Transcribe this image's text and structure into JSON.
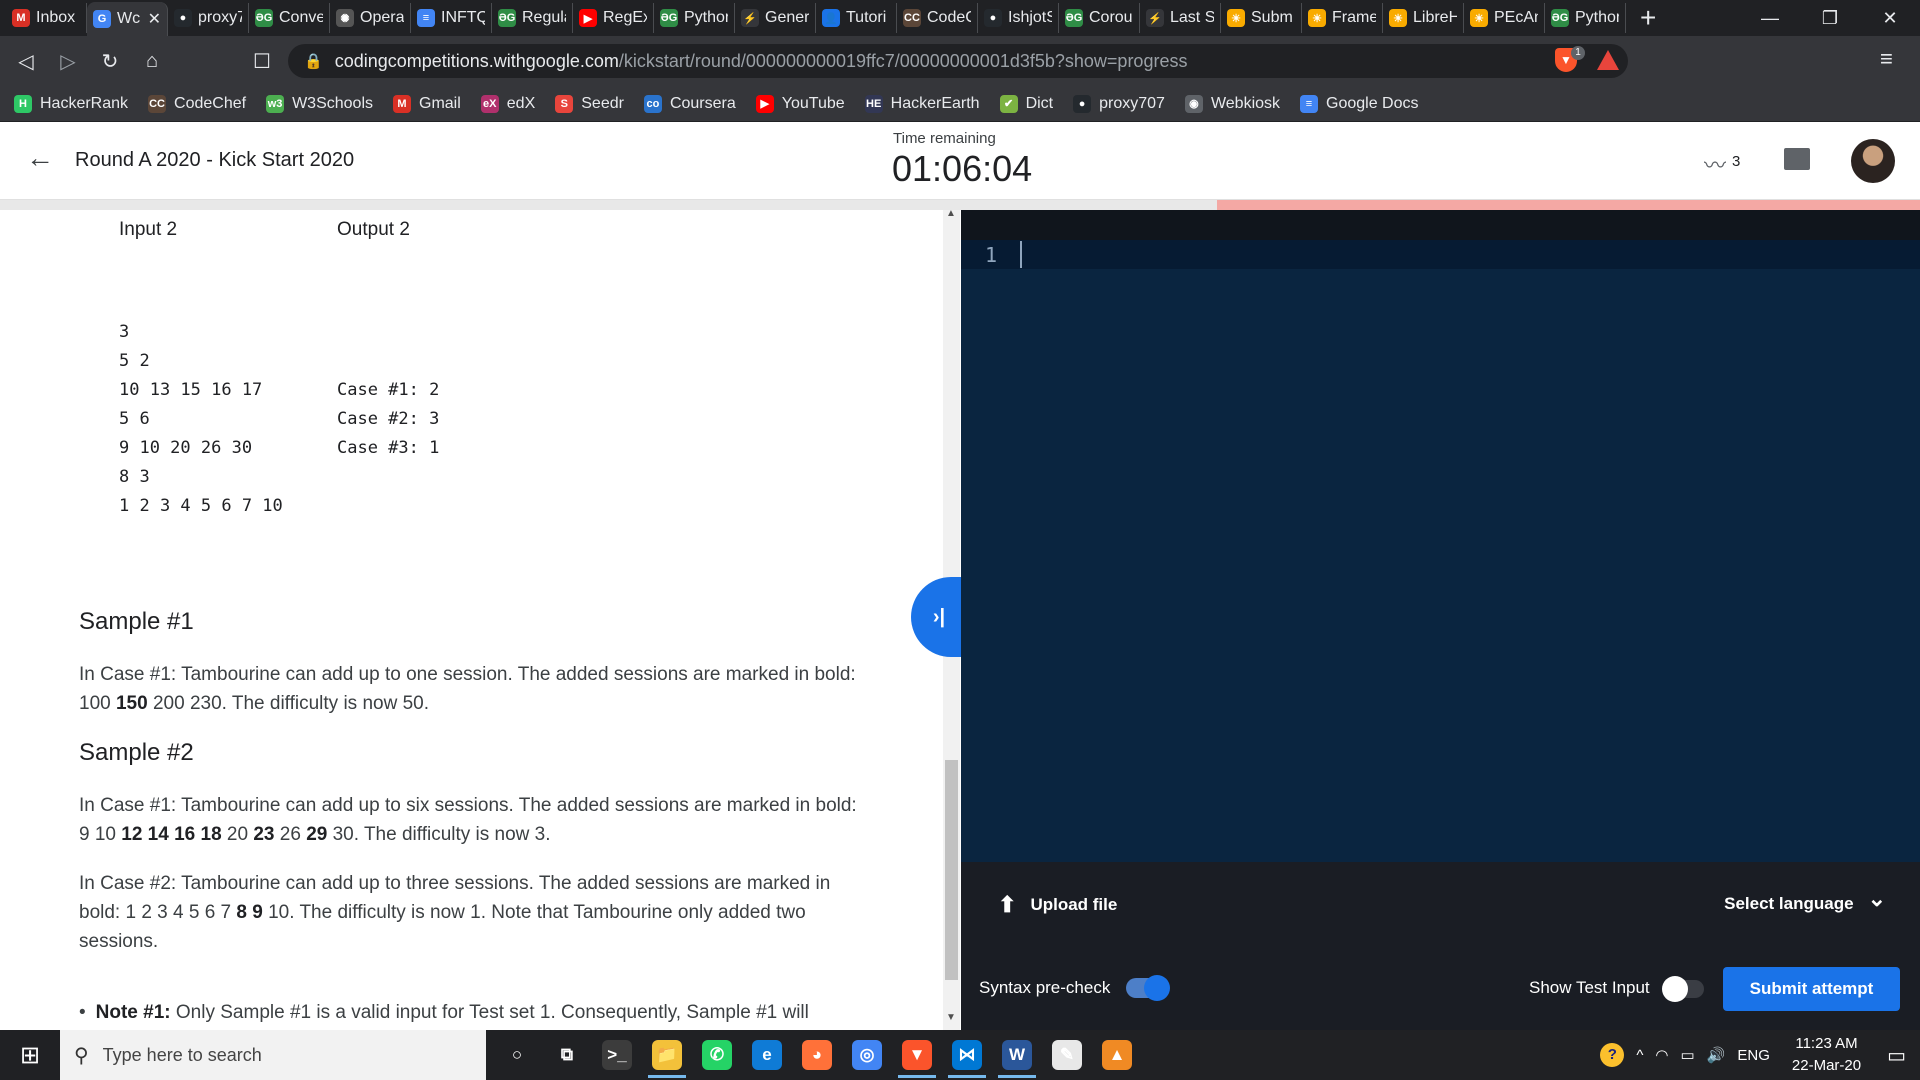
{
  "browser": {
    "tabs": [
      {
        "label": "Inbox",
        "icon": "gmail-icon",
        "color": "#d93025",
        "glyph": "M"
      },
      {
        "label": "Wc",
        "icon": "google-icon",
        "color": "#4285f4",
        "glyph": "G",
        "active": true,
        "close": "✕"
      },
      {
        "label": "proxy7",
        "icon": "github-icon",
        "color": "#24292e",
        "glyph": "●"
      },
      {
        "label": "Conve",
        "icon": "geeksforgeeks-icon",
        "color": "#2f8d46",
        "glyph": "ƏG"
      },
      {
        "label": "Opera",
        "icon": "openai-icon",
        "color": "#555555",
        "glyph": "✺"
      },
      {
        "label": "INFTQ",
        "icon": "docs-icon",
        "color": "#4285f4",
        "glyph": "≡"
      },
      {
        "label": "Regula",
        "icon": "geeksforgeeks-icon",
        "color": "#2f8d46",
        "glyph": "ƏG"
      },
      {
        "label": "RegEx",
        "icon": "youtube-icon",
        "color": "#ff0000",
        "glyph": "▶"
      },
      {
        "label": "Pythor",
        "icon": "geeksforgeeks-icon",
        "color": "#2f8d46",
        "glyph": "ƏG"
      },
      {
        "label": "Gener",
        "icon": "hackerrank-icon",
        "color": "#35363a",
        "glyph": "⚡"
      },
      {
        "label": "Tutori",
        "icon": "user-icon",
        "color": "#1a73e8",
        "glyph": "👤"
      },
      {
        "label": "CodeC",
        "icon": "codechef-icon",
        "color": "#5b4638",
        "glyph": "CC"
      },
      {
        "label": "IshjotS",
        "icon": "github-icon",
        "color": "#24292e",
        "glyph": "●"
      },
      {
        "label": "Corou",
        "icon": "geeksforgeeks-icon",
        "color": "#2f8d46",
        "glyph": "ƏG"
      },
      {
        "label": "Last St",
        "icon": "hackerrank-icon",
        "color": "#35363a",
        "glyph": "⚡"
      },
      {
        "label": "Subm",
        "icon": "sun-icon",
        "color": "#f9ab00",
        "glyph": "☀"
      },
      {
        "label": "Frame",
        "icon": "sun-icon",
        "color": "#f9ab00",
        "glyph": "☀"
      },
      {
        "label": "LibreH",
        "icon": "sun-icon",
        "color": "#f9ab00",
        "glyph": "☀"
      },
      {
        "label": "PEcAn",
        "icon": "sun-icon",
        "color": "#f9ab00",
        "glyph": "☀"
      },
      {
        "label": "Pythor",
        "icon": "geeksforgeeks-icon",
        "color": "#2f8d46",
        "glyph": "ƏG"
      }
    ],
    "new_tab": "+",
    "window_controls": {
      "minimize": "—",
      "restore": "❐",
      "close": "✕"
    },
    "nav": {
      "back": "◁",
      "forward": "▷",
      "reload": "↻",
      "home": "⌂",
      "bookmark": "☐"
    },
    "url_host": "codingcompetitions.withgoogle.com",
    "url_path": "/kickstart/round/000000000019ffc7/00000000001d3f5b?show=progress",
    "brave_badge": "1",
    "menu": "≡",
    "bookmarks": [
      {
        "label": "HackerRank",
        "icon": "hackerrank-icon",
        "color": "#2ec866",
        "glyph": "H"
      },
      {
        "label": "CodeChef",
        "icon": "codechef-icon",
        "color": "#5b4638",
        "glyph": "CC"
      },
      {
        "label": "W3Schools",
        "icon": "w3schools-icon",
        "color": "#4caf50",
        "glyph": "w3"
      },
      {
        "label": "Gmail",
        "icon": "gmail-icon",
        "color": "#d93025",
        "glyph": "M"
      },
      {
        "label": "edX",
        "icon": "edx-icon",
        "color": "#b0306c",
        "glyph": "eX"
      },
      {
        "label": "Seedr",
        "icon": "seedr-icon",
        "color": "#e8453c",
        "glyph": "S"
      },
      {
        "label": "Coursera",
        "icon": "coursera-icon",
        "color": "#2a73cc",
        "glyph": "co"
      },
      {
        "label": "YouTube",
        "icon": "youtube-icon",
        "color": "#ff0000",
        "glyph": "▶"
      },
      {
        "label": "HackerEarth",
        "icon": "hackerearth-icon",
        "color": "#323754",
        "glyph": "HE"
      },
      {
        "label": "Dict",
        "icon": "leaf-icon",
        "color": "#7cb342",
        "glyph": "✔"
      },
      {
        "label": "proxy707",
        "icon": "github-icon",
        "color": "#24292e",
        "glyph": "●"
      },
      {
        "label": "Webkiosk",
        "icon": "globe-icon",
        "color": "#5f6368",
        "glyph": "◉"
      },
      {
        "label": "Google Docs",
        "icon": "docs-icon",
        "color": "#4285f4",
        "glyph": "≡"
      }
    ]
  },
  "app": {
    "back_icon": "←",
    "title": "Round A 2020 - Kick Start 2020",
    "time_label": "Time remaining",
    "time_value": "01:06:04",
    "scoreboard_count": "3",
    "progress_fraction": 0.366
  },
  "problem": {
    "io_headers": {
      "input": "Input 2",
      "output": "Output 2"
    },
    "input_lines": [
      "3",
      "5 2",
      "10 13 15 16 17",
      "5 6",
      "9 10 20 26 30",
      "8 3",
      "1 2 3 4 5 6 7 10"
    ],
    "output_lines": [
      "Case #1: 2",
      "Case #2: 3",
      "Case #3: 1"
    ],
    "toggle_icon": "›|",
    "sample1": {
      "heading": "Sample #1",
      "text_a": "In Case #1: Tambourine can add up to one session. The added sessions are marked in bold: 100 ",
      "bold": "150",
      "text_b": " 200 230. The difficulty is now 50."
    },
    "sample2": {
      "heading": "Sample #2",
      "p1_a": "In Case #1: Tambourine can add up to six sessions. The added sessions are marked in bold: 9 10 ",
      "p1_bold1": "12 14 16 18",
      "p1_b": " 20 ",
      "p1_bold2": "23",
      "p1_c": " 26 ",
      "p1_bold3": "29",
      "p1_d": " 30. The difficulty is now 3.",
      "p2_a": "In Case #2: Tambourine can add up to three sessions. The added sessions are marked in bold: 1 2 3 4 5 6 7 ",
      "p2_bold": "8 9",
      "p2_b": " 10. The difficulty is now 1. Note that Tambourine only added two sessions."
    },
    "note_bold": "Note #1:",
    "note_text": " Only Sample #1 is a valid input for Test set 1. Consequently, Sample #1 will"
  },
  "editor": {
    "line_number": "1",
    "upload_label": "Upload file",
    "upload_icon": "⬆",
    "language_label": "Select language",
    "language_chevron": "⌄",
    "syntax_label": "Syntax pre-check",
    "syntax_on": true,
    "show_test_label": "Show Test Input",
    "show_test_on": false,
    "submit_label": "Submit attempt",
    "accent": "#1a73e8"
  },
  "taskbar": {
    "start_icon": "⊞",
    "search_placeholder": "Type here to search",
    "apps": [
      {
        "name": "cortana-icon",
        "glyph": "○",
        "color": "transparent"
      },
      {
        "name": "task-view-icon",
        "glyph": "⧉",
        "color": "transparent"
      },
      {
        "name": "terminal-icon",
        "glyph": ">_",
        "color": "#3c3c3c"
      },
      {
        "name": "file-explorer-icon",
        "glyph": "📁",
        "color": "#f3c13a",
        "active": true
      },
      {
        "name": "whatsapp-icon",
        "glyph": "✆",
        "color": "#25d366"
      },
      {
        "name": "edge-icon",
        "glyph": "e",
        "color": "#0f7bd6"
      },
      {
        "name": "firefox-icon",
        "glyph": "◕",
        "color": "#ff7139"
      },
      {
        "name": "chrome-icon",
        "glyph": "◎",
        "color": "#4285f4"
      },
      {
        "name": "brave-icon",
        "glyph": "▼",
        "color": "#fb542b",
        "active": true
      },
      {
        "name": "vscode-icon",
        "glyph": "⋈",
        "color": "#0078d4",
        "active": true
      },
      {
        "name": "word-icon",
        "glyph": "W",
        "color": "#2b579a",
        "active": true
      },
      {
        "name": "notepad-icon",
        "glyph": "✎",
        "color": "#e8e8e8"
      },
      {
        "name": "vlc-icon",
        "glyph": "▲",
        "color": "#f08a24"
      }
    ],
    "tray": {
      "help": "?",
      "chevron": "^",
      "wifi": "◠",
      "battery": "▭",
      "volume": "🔊",
      "lang": "ENG",
      "time": "11:23 AM",
      "date": "22-Mar-20",
      "notifications": "▭"
    }
  }
}
